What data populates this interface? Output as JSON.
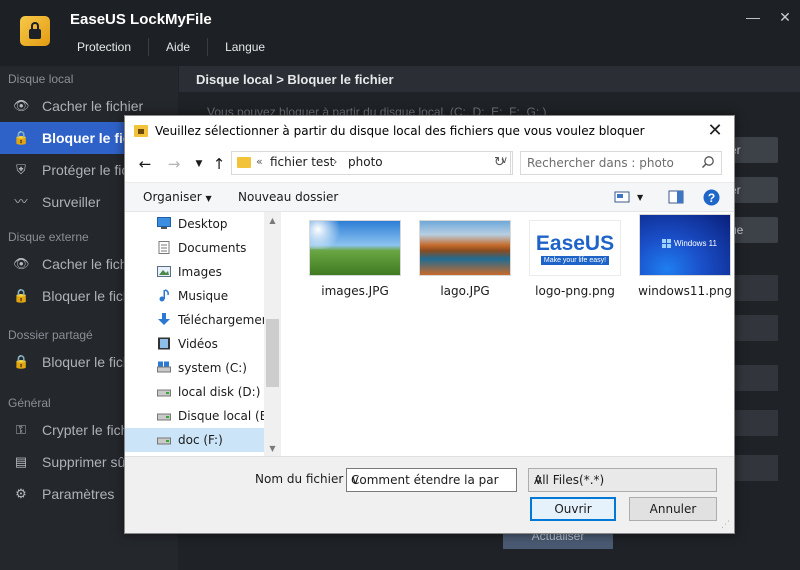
{
  "app": {
    "title": "EaseUS LockMyFile",
    "menu": [
      "Protection",
      "Aide",
      "Langue"
    ]
  },
  "sidebar": {
    "sections": [
      {
        "label": "Disque local",
        "items": [
          {
            "label": "Cacher le fichier",
            "icon": "eye-slash-icon"
          },
          {
            "label": "Bloquer le fichier",
            "icon": "lock-icon",
            "active": true
          },
          {
            "label": "Protéger le fichier",
            "icon": "shield-icon"
          },
          {
            "label": "Surveiller",
            "icon": "monitor-icon"
          }
        ]
      },
      {
        "label": "Disque externe",
        "items": [
          {
            "label": "Cacher le fichier",
            "icon": "eye-slash-icon"
          },
          {
            "label": "Bloquer le fichier",
            "icon": "lock-icon"
          }
        ]
      },
      {
        "label": "Dossier partagé",
        "items": [
          {
            "label": "Bloquer le fichier",
            "icon": "lock-icon"
          }
        ]
      },
      {
        "label": "Général",
        "items": [
          {
            "label": "Crypter le fichier",
            "icon": "encrypt-icon"
          },
          {
            "label": "Supprimer sûrement",
            "icon": "shredder-icon"
          },
          {
            "label": "Paramètres",
            "icon": "gear-icon"
          }
        ]
      }
    ]
  },
  "content": {
    "breadcrumb": "Disque local > Bloquer le fichier",
    "radio_text": "Vous pouvez bloquer à partir du disque local. (C:, D:, E:, F:, G:.)",
    "side_buttons": [
      "er",
      "er",
      "ue"
    ],
    "update_button": "Actualiser"
  },
  "dialog": {
    "title": "Veuillez sélectionner à partir du disque local des fichiers que vous voulez bloquer",
    "address": {
      "prefix": "«",
      "segments": [
        "fichier test",
        "photo"
      ]
    },
    "search_placeholder": "Rechercher dans : photo",
    "toolbar": {
      "organize": "Organiser",
      "new_folder": "Nouveau dossier"
    },
    "nav_items": [
      {
        "label": "Desktop",
        "icon": "desktop-icon"
      },
      {
        "label": "Documents",
        "icon": "documents-icon"
      },
      {
        "label": "Images",
        "icon": "images-icon"
      },
      {
        "label": "Musique",
        "icon": "music-icon"
      },
      {
        "label": "Téléchargements",
        "icon": "download-icon"
      },
      {
        "label": "Vidéos",
        "icon": "videos-icon"
      },
      {
        "label": "system (C:)",
        "icon": "system-drive-icon"
      },
      {
        "label": "local disk (D:)",
        "icon": "drive-icon"
      },
      {
        "label": "Disque local (E:)",
        "icon": "drive-icon"
      },
      {
        "label": "doc (F:)",
        "icon": "drive-icon",
        "selected": true
      }
    ],
    "files": [
      {
        "name": "images.JPG",
        "thumb": "landscape-thumbnail"
      },
      {
        "name": "lago.JPG",
        "thumb": "lake-thumbnail"
      },
      {
        "name": "logo-png.png",
        "thumb": "easeus-logo-thumbnail",
        "logo_text": "EaseUS",
        "logo_tagline": "Make your life easy!"
      },
      {
        "name": "windows11.png",
        "thumb": "windows11-thumbnail",
        "logo_text": "Windows 11"
      }
    ],
    "filename_label": "Nom du fichier :",
    "filename_value": "Comment étendre la partition",
    "filter_value": "All Files(*.*)",
    "open_button": "Ouvrir",
    "cancel_button": "Annuler"
  },
  "colors": {
    "accent": "#2f62c8",
    "sidebar_bg": "#24272c",
    "dialog_primary_border": "#0078d7"
  }
}
